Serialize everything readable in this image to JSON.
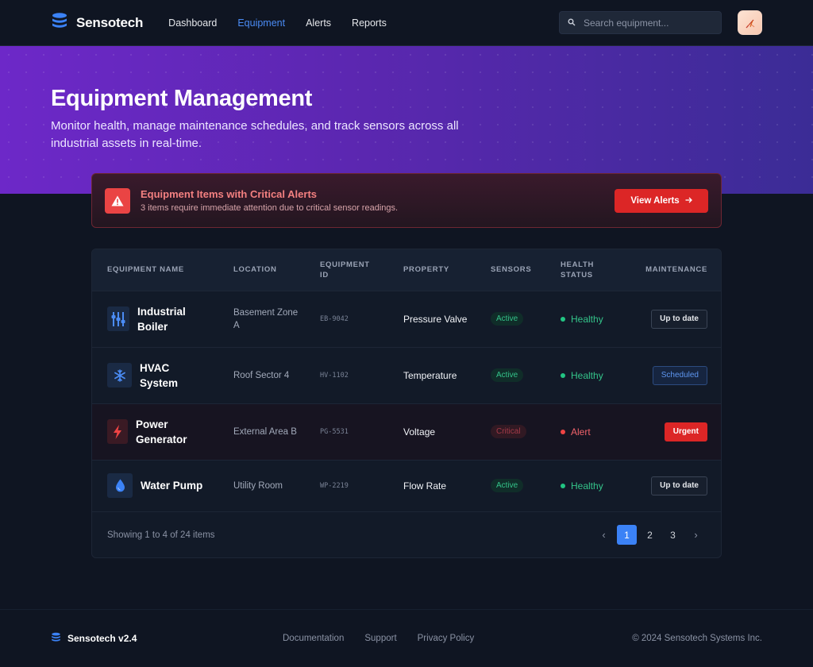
{
  "brand": {
    "name": "Sensotech",
    "icon": "database-icon",
    "color": "#3b82f6"
  },
  "nav": {
    "links": [
      {
        "label": "Dashboard",
        "active": false
      },
      {
        "label": "Equipment",
        "active": true
      },
      {
        "label": "Alerts",
        "active": false
      },
      {
        "label": "Reports",
        "active": false
      }
    ],
    "search_placeholder": "Search equipment..."
  },
  "hero": {
    "title": "Equipment Management",
    "subtitle": "Monitor health, manage maintenance schedules, and track sensors across all industrial assets in real-time."
  },
  "alert": {
    "title": "Equipment Items with Critical Alerts",
    "description": "3 items require immediate attention due to critical sensor readings.",
    "button_label": "View Alerts",
    "icon": "warning-icon"
  },
  "table": {
    "columns": [
      "Equipment Name",
      "Location",
      "Equipment ID",
      "Property",
      "Sensors",
      "Health Status",
      "Maintenance"
    ],
    "rows": [
      {
        "name": "Industrial Boiler",
        "icon": "boiler-icon",
        "location": "Basement Zone A",
        "id": "EB-9042",
        "property": "Pressure Valve",
        "sensors": "Active",
        "health": "Healthy",
        "maintenance": "Up to date"
      },
      {
        "name": "HVAC System",
        "icon": "snowflake-icon",
        "location": "Roof Sector 4",
        "id": "HV-1102",
        "property": "Temperature",
        "sensors": "Active",
        "health": "Healthy",
        "maintenance": "Scheduled"
      },
      {
        "name": "Power Generator",
        "icon": "lightning-icon",
        "location": "External Area B",
        "id": "PG-5531",
        "property": "Voltage",
        "sensors": "Critical",
        "health": "Alert",
        "maintenance": "Urgent"
      },
      {
        "name": "Water Pump",
        "icon": "water-drop-icon",
        "location": "Utility Room",
        "id": "WP-2219",
        "property": "Flow Rate",
        "sensors": "Active",
        "health": "Healthy",
        "maintenance": "Up to date"
      }
    ],
    "showing": "Showing 1 to 4 of 24 items",
    "pages": [
      "1",
      "2",
      "3"
    ],
    "current_page": "1",
    "prev": "‹",
    "next": "›"
  },
  "footer": {
    "brand": "Sensotech v2.4",
    "links": [
      "Documentation",
      "Support",
      "Privacy Policy"
    ],
    "copyright": "© 2024 Sensotech Systems Inc."
  },
  "colors": {
    "accent": "#3b82f6",
    "healthy": "#22c583",
    "critical": "#ef4444",
    "hero_start": "#6d28c8",
    "hero_end": "#3b2c96"
  }
}
